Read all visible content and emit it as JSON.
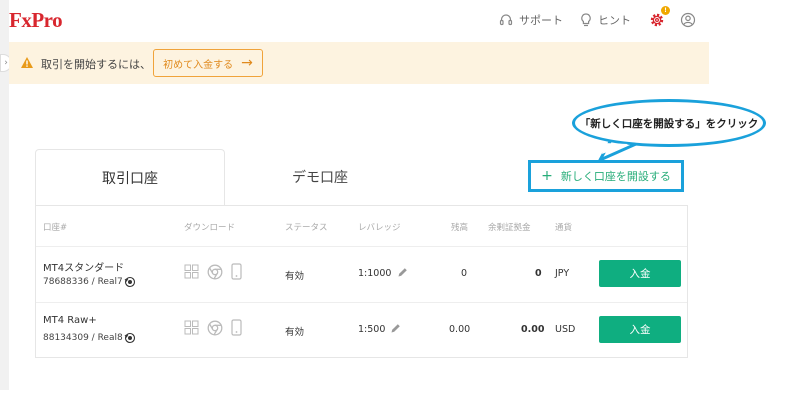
{
  "header": {
    "logo": "FxPro",
    "support_label": "サポート",
    "hint_label": "ヒント",
    "notification_count": "!",
    "icons": [
      "headset-icon",
      "lightbulb-icon",
      "gear-icon",
      "user-icon"
    ]
  },
  "banner": {
    "text": "取引を開始するには、",
    "button_label": "初めて入金する"
  },
  "annotation": {
    "text": "「新しく口座を開設する」をクリック"
  },
  "tabs": [
    {
      "label": "取引口座",
      "active": true
    },
    {
      "label": "デモ口座",
      "active": false
    }
  ],
  "open_account_label": "新しく口座を開設する",
  "table": {
    "columns": [
      "口座#",
      "ダウンロード",
      "ステータス",
      "レバレッジ",
      "残高",
      "余剰証拠金",
      "通貨"
    ],
    "rows": [
      {
        "name": "MT4スタンダード",
        "sub": "78688336 / Real7",
        "status": "有効",
        "leverage": "1:1000",
        "balance": "0",
        "free_margin": "0",
        "currency": "JPY",
        "action": "入金"
      },
      {
        "name": "MT4 Raw+",
        "sub": "88134309 / Real8",
        "status": "有効",
        "leverage": "1:500",
        "balance": "0.00",
        "free_margin": "0.00",
        "currency": "USD",
        "action": "入金"
      }
    ]
  },
  "colors": {
    "brand_red": "#d8262e",
    "banner_bg": "#fdf3e0",
    "accent_orange": "#f0a33a",
    "green": "#0fae80",
    "highlight_blue": "#1aa1db"
  }
}
